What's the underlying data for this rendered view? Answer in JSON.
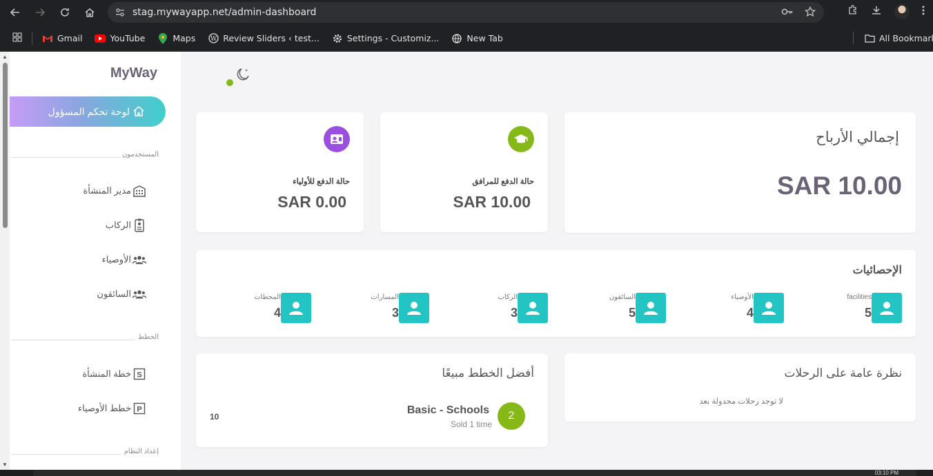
{
  "browser": {
    "url_domain": "stag.mywayapp.net",
    "url_path": "/admin-dashboard",
    "bookmarks": [
      {
        "label": "Gmail",
        "icon": "gmail-icon",
        "color": "#ea4335"
      },
      {
        "label": "YouTube",
        "icon": "youtube-icon",
        "color": "#ff0000"
      },
      {
        "label": "Maps",
        "icon": "maps-icon",
        "color": "#34a853"
      },
      {
        "label": "Review Sliders ‹ test...",
        "icon": "wordpress-icon",
        "color": "#e3e3e3"
      },
      {
        "label": "Settings - Customiz...",
        "icon": "gear-icon",
        "color": "#e3e3e3"
      },
      {
        "label": "New Tab",
        "icon": "globe-icon",
        "color": "#e3e3e3"
      }
    ],
    "all_bookmarks": "All Bookmarks"
  },
  "sidebar": {
    "brand": "MyWay",
    "active_item": "لوحة تحكم المسؤول",
    "section_users": "المستخدمون",
    "users_items": [
      {
        "label": "مدير المنشأة",
        "icon": "building-icon"
      },
      {
        "label": "الركاب",
        "icon": "id-badge-icon"
      },
      {
        "label": "الأوصياء",
        "icon": "users-icon"
      },
      {
        "label": "السائقون",
        "icon": "users-icon"
      }
    ],
    "section_plans": "الخطط",
    "plans_items": [
      {
        "label": "خطة المنشأة",
        "icon": "plan-s-icon"
      },
      {
        "label": "خطط الأوصياء",
        "icon": "plan-p-icon"
      }
    ],
    "section_settings": "إعداد النظام"
  },
  "summary": {
    "total_profit_title": "إجمالي الأرباح",
    "total_profit_value": "SAR 10.00",
    "escort_payment_label": "حالة الدفع للمرافق",
    "escort_payment_value": "SAR 10.00",
    "parents_payment_label": "حالة الدفع للأولياء",
    "parents_payment_value": "SAR 0.00",
    "escort_icon_color": "#86b817",
    "parents_icon_color": "#9b4fe0"
  },
  "stats": {
    "title": "الإحصائيات",
    "items": [
      {
        "label": "facilities",
        "value": "5"
      },
      {
        "label": "الأوصياء",
        "value": "4"
      },
      {
        "label": "السائقون",
        "value": "5"
      },
      {
        "label": "الركاب",
        "value": "3"
      },
      {
        "label": "المسارات",
        "value": "3"
      },
      {
        "label": "المحطات",
        "value": "4"
      }
    ]
  },
  "trips": {
    "title": "نظرة عامة على الرحلات",
    "empty": "لا توجد رحلات مجدولة بعد"
  },
  "plans": {
    "title": "أفضل الخطط مبيعًا",
    "item_rank": "2",
    "item_name": "Basic - Schools",
    "item_sold": "Sold 1 time",
    "item_amount": "10"
  },
  "taskbar": {
    "time": "03:10 PM"
  }
}
